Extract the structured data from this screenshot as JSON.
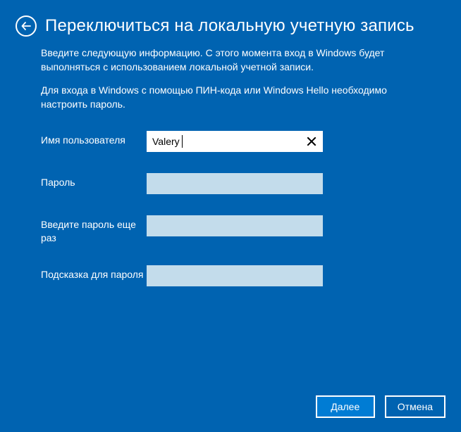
{
  "header": {
    "title": "Переключиться на локальную учетную запись"
  },
  "description": {
    "p1": "Введите следующую информацию. С этого момента вход в Windows будет выполняться с использованием локальной учетной записи.",
    "p2": "Для входа в Windows с помощью ПИН-кода или Windows Hello необходимо настроить пароль."
  },
  "form": {
    "username_label": "Имя пользователя",
    "username_value": "Valery",
    "password_label": "Пароль",
    "password_value": "",
    "confirm_label": "Введите пароль еще раз",
    "confirm_value": "",
    "hint_label": "Подсказка для пароля",
    "hint_value": ""
  },
  "footer": {
    "next": "Далее",
    "cancel": "Отмена"
  }
}
